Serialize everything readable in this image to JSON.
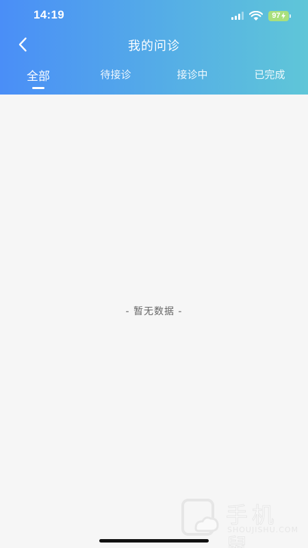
{
  "status_bar": {
    "time": "14:19",
    "battery": "97",
    "icons": [
      "signal-icon",
      "wifi-icon",
      "battery-charging-icon"
    ]
  },
  "nav": {
    "back_icon": "chevron-left-icon",
    "title": "我的问诊"
  },
  "tabs": [
    {
      "label": "全部",
      "active": true
    },
    {
      "label": "待接诊",
      "active": false
    },
    {
      "label": "接诊中",
      "active": false
    },
    {
      "label": "已完成",
      "active": false
    }
  ],
  "content": {
    "empty_text": "- 暂无数据 -"
  },
  "watermark": {
    "text_cn": "手机鼠",
    "text_en": "SHOUJISHU.COM"
  },
  "colors": {
    "header_gradient_start": "#4a8ef7",
    "header_gradient_end": "#5fc6d8",
    "page_background": "#f6f6f6",
    "battery_fill": "#a9e07d"
  }
}
